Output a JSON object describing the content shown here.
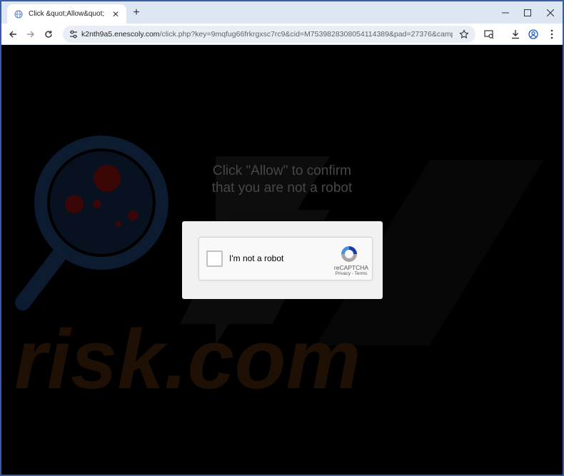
{
  "browser": {
    "tab_title": "Click &quot;Allow&quot;",
    "tab_close": "✕",
    "new_tab": "+",
    "url_host": "k2nth9a5.enescoly.com",
    "url_path": "/click.php?key=9mqfug66frkrgxsc7rc9&cid=M7539828308054114389&pad=27376&campaign…"
  },
  "page": {
    "headline_line1": "Click \"Allow\" to confirm",
    "headline_line2": "that you are not a robot"
  },
  "captcha": {
    "label": "I'm not a robot",
    "brand": "reCAPTCHA",
    "links": "Privacy - Terms",
    "checked": false
  },
  "watermark": {
    "text": "risk.com",
    "colors": {
      "orange": "#2a1506",
      "blue": "#0b1a2e",
      "red": "#3a0606"
    }
  }
}
